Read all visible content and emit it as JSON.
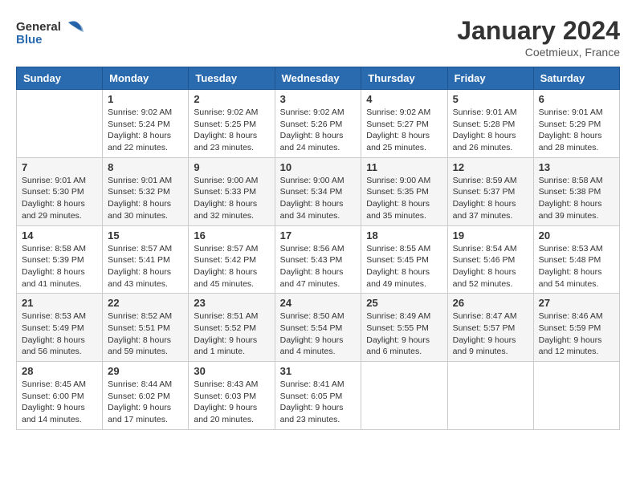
{
  "header": {
    "logo_general": "General",
    "logo_blue": "Blue",
    "month": "January 2024",
    "location": "Coetmieux, France"
  },
  "weekdays": [
    "Sunday",
    "Monday",
    "Tuesday",
    "Wednesday",
    "Thursday",
    "Friday",
    "Saturday"
  ],
  "weeks": [
    [
      {
        "day": "",
        "info": ""
      },
      {
        "day": "1",
        "info": "Sunrise: 9:02 AM\nSunset: 5:24 PM\nDaylight: 8 hours\nand 22 minutes."
      },
      {
        "day": "2",
        "info": "Sunrise: 9:02 AM\nSunset: 5:25 PM\nDaylight: 8 hours\nand 23 minutes."
      },
      {
        "day": "3",
        "info": "Sunrise: 9:02 AM\nSunset: 5:26 PM\nDaylight: 8 hours\nand 24 minutes."
      },
      {
        "day": "4",
        "info": "Sunrise: 9:02 AM\nSunset: 5:27 PM\nDaylight: 8 hours\nand 25 minutes."
      },
      {
        "day": "5",
        "info": "Sunrise: 9:01 AM\nSunset: 5:28 PM\nDaylight: 8 hours\nand 26 minutes."
      },
      {
        "day": "6",
        "info": "Sunrise: 9:01 AM\nSunset: 5:29 PM\nDaylight: 8 hours\nand 28 minutes."
      }
    ],
    [
      {
        "day": "7",
        "info": "Sunrise: 9:01 AM\nSunset: 5:30 PM\nDaylight: 8 hours\nand 29 minutes."
      },
      {
        "day": "8",
        "info": "Sunrise: 9:01 AM\nSunset: 5:32 PM\nDaylight: 8 hours\nand 30 minutes."
      },
      {
        "day": "9",
        "info": "Sunrise: 9:00 AM\nSunset: 5:33 PM\nDaylight: 8 hours\nand 32 minutes."
      },
      {
        "day": "10",
        "info": "Sunrise: 9:00 AM\nSunset: 5:34 PM\nDaylight: 8 hours\nand 34 minutes."
      },
      {
        "day": "11",
        "info": "Sunrise: 9:00 AM\nSunset: 5:35 PM\nDaylight: 8 hours\nand 35 minutes."
      },
      {
        "day": "12",
        "info": "Sunrise: 8:59 AM\nSunset: 5:37 PM\nDaylight: 8 hours\nand 37 minutes."
      },
      {
        "day": "13",
        "info": "Sunrise: 8:58 AM\nSunset: 5:38 PM\nDaylight: 8 hours\nand 39 minutes."
      }
    ],
    [
      {
        "day": "14",
        "info": "Sunrise: 8:58 AM\nSunset: 5:39 PM\nDaylight: 8 hours\nand 41 minutes."
      },
      {
        "day": "15",
        "info": "Sunrise: 8:57 AM\nSunset: 5:41 PM\nDaylight: 8 hours\nand 43 minutes."
      },
      {
        "day": "16",
        "info": "Sunrise: 8:57 AM\nSunset: 5:42 PM\nDaylight: 8 hours\nand 45 minutes."
      },
      {
        "day": "17",
        "info": "Sunrise: 8:56 AM\nSunset: 5:43 PM\nDaylight: 8 hours\nand 47 minutes."
      },
      {
        "day": "18",
        "info": "Sunrise: 8:55 AM\nSunset: 5:45 PM\nDaylight: 8 hours\nand 49 minutes."
      },
      {
        "day": "19",
        "info": "Sunrise: 8:54 AM\nSunset: 5:46 PM\nDaylight: 8 hours\nand 52 minutes."
      },
      {
        "day": "20",
        "info": "Sunrise: 8:53 AM\nSunset: 5:48 PM\nDaylight: 8 hours\nand 54 minutes."
      }
    ],
    [
      {
        "day": "21",
        "info": "Sunrise: 8:53 AM\nSunset: 5:49 PM\nDaylight: 8 hours\nand 56 minutes."
      },
      {
        "day": "22",
        "info": "Sunrise: 8:52 AM\nSunset: 5:51 PM\nDaylight: 8 hours\nand 59 minutes."
      },
      {
        "day": "23",
        "info": "Sunrise: 8:51 AM\nSunset: 5:52 PM\nDaylight: 9 hours\nand 1 minute."
      },
      {
        "day": "24",
        "info": "Sunrise: 8:50 AM\nSunset: 5:54 PM\nDaylight: 9 hours\nand 4 minutes."
      },
      {
        "day": "25",
        "info": "Sunrise: 8:49 AM\nSunset: 5:55 PM\nDaylight: 9 hours\nand 6 minutes."
      },
      {
        "day": "26",
        "info": "Sunrise: 8:47 AM\nSunset: 5:57 PM\nDaylight: 9 hours\nand 9 minutes."
      },
      {
        "day": "27",
        "info": "Sunrise: 8:46 AM\nSunset: 5:59 PM\nDaylight: 9 hours\nand 12 minutes."
      }
    ],
    [
      {
        "day": "28",
        "info": "Sunrise: 8:45 AM\nSunset: 6:00 PM\nDaylight: 9 hours\nand 14 minutes."
      },
      {
        "day": "29",
        "info": "Sunrise: 8:44 AM\nSunset: 6:02 PM\nDaylight: 9 hours\nand 17 minutes."
      },
      {
        "day": "30",
        "info": "Sunrise: 8:43 AM\nSunset: 6:03 PM\nDaylight: 9 hours\nand 20 minutes."
      },
      {
        "day": "31",
        "info": "Sunrise: 8:41 AM\nSunset: 6:05 PM\nDaylight: 9 hours\nand 23 minutes."
      },
      {
        "day": "",
        "info": ""
      },
      {
        "day": "",
        "info": ""
      },
      {
        "day": "",
        "info": ""
      }
    ]
  ]
}
